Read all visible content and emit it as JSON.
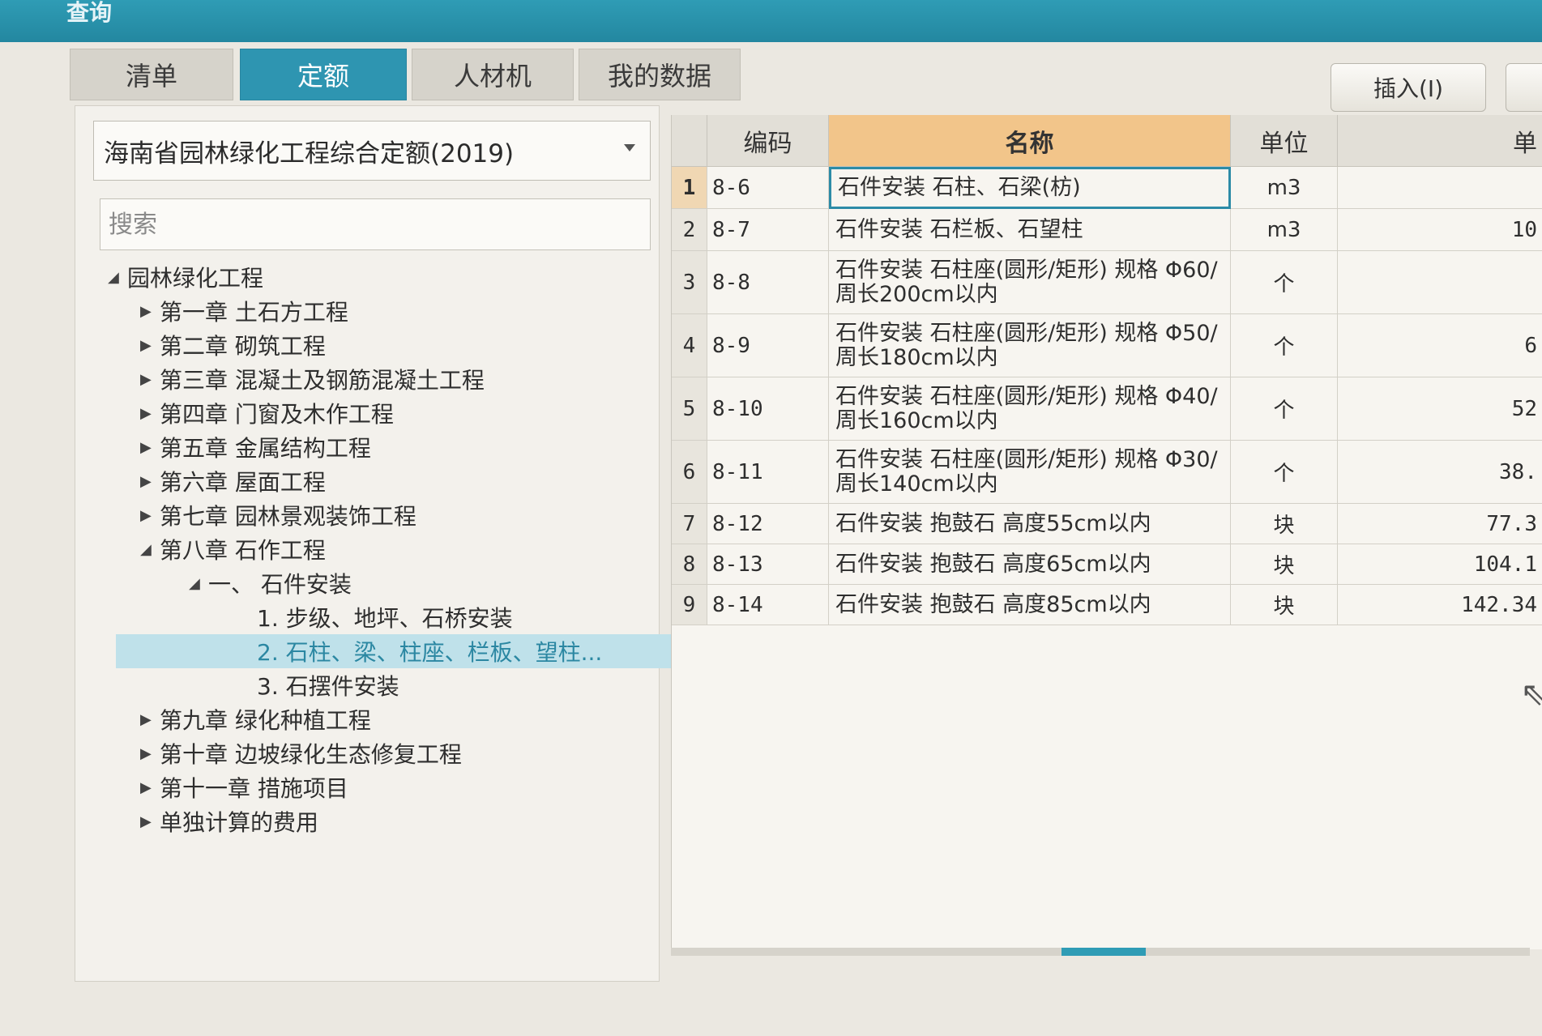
{
  "window": {
    "title": "查询"
  },
  "tabs": [
    {
      "label": "清单",
      "active": false
    },
    {
      "label": "定额",
      "active": true
    },
    {
      "label": "人材机",
      "active": false
    },
    {
      "label": "我的数据",
      "active": false
    }
  ],
  "toolbar": {
    "insert_label": "插入(I)"
  },
  "left": {
    "quota_library": "海南省园林绿化工程综合定额(2019)",
    "search_placeholder": "搜索",
    "tree": [
      {
        "label": "园林绿化工程",
        "arrow": "◢",
        "indent": 0
      },
      {
        "label": "第一章 土石方工程",
        "arrow": "▶",
        "indent": 1
      },
      {
        "label": "第二章 砌筑工程",
        "arrow": "▶",
        "indent": 1
      },
      {
        "label": "第三章 混凝土及钢筋混凝土工程",
        "arrow": "▶",
        "indent": 1
      },
      {
        "label": "第四章 门窗及木作工程",
        "arrow": "▶",
        "indent": 1
      },
      {
        "label": "第五章 金属结构工程",
        "arrow": "▶",
        "indent": 1
      },
      {
        "label": "第六章 屋面工程",
        "arrow": "▶",
        "indent": 1
      },
      {
        "label": "第七章 园林景观装饰工程",
        "arrow": "▶",
        "indent": 1
      },
      {
        "label": "第八章 石作工程",
        "arrow": "◢",
        "indent": 1
      },
      {
        "label": "一、 石件安装",
        "arrow": "◢",
        "indent": 2
      },
      {
        "label": "1. 步级、地坪、石桥安装",
        "arrow": "",
        "indent": 3
      },
      {
        "label": "2. 石柱、梁、柱座、栏板、望柱...",
        "arrow": "",
        "indent": 3,
        "selected": true
      },
      {
        "label": "3. 石摆件安装",
        "arrow": "",
        "indent": 3
      },
      {
        "label": "第九章 绿化种植工程",
        "arrow": "▶",
        "indent": 1
      },
      {
        "label": "第十章 边坡绿化生态修复工程",
        "arrow": "▶",
        "indent": 1
      },
      {
        "label": "第十一章 措施项目",
        "arrow": "▶",
        "indent": 1
      },
      {
        "label": "单独计算的费用",
        "arrow": "▶",
        "indent": 1
      }
    ]
  },
  "grid": {
    "columns": {
      "code": "编码",
      "name": "名称",
      "unit": "单位",
      "price": "单"
    },
    "rows": [
      {
        "idx": "1",
        "code": "8-6",
        "name": "石件安装 石柱、石梁(枋)",
        "unit": "m3",
        "price": ""
      },
      {
        "idx": "2",
        "code": "8-7",
        "name": "石件安装 石栏板、石望柱",
        "unit": "m3",
        "price": "10"
      },
      {
        "idx": "3",
        "code": "8-8",
        "name": "石件安装 石柱座(圆形/矩形) 规格 Φ60/周长200cm以内",
        "unit": "个",
        "price": ""
      },
      {
        "idx": "4",
        "code": "8-9",
        "name": "石件安装 石柱座(圆形/矩形) 规格 Φ50/周长180cm以内",
        "unit": "个",
        "price": "6"
      },
      {
        "idx": "5",
        "code": "8-10",
        "name": "石件安装 石柱座(圆形/矩形) 规格 Φ40/周长160cm以内",
        "unit": "个",
        "price": "52"
      },
      {
        "idx": "6",
        "code": "8-11",
        "name": "石件安装 石柱座(圆形/矩形) 规格 Φ30/周长140cm以内",
        "unit": "个",
        "price": "38."
      },
      {
        "idx": "7",
        "code": "8-12",
        "name": "石件安装 抱鼓石 高度55cm以内",
        "unit": "块",
        "price": "77.3"
      },
      {
        "idx": "8",
        "code": "8-13",
        "name": "石件安装 抱鼓石 高度65cm以内",
        "unit": "块",
        "price": "104.1"
      },
      {
        "idx": "9",
        "code": "8-14",
        "name": "石件安装 抱鼓石 高度85cm以内",
        "unit": "块",
        "price": "142.34"
      }
    ]
  },
  "colors": {
    "accent": "#2e95b1",
    "header_name_bg": "#f2c58a",
    "selection": "#bfe1ea"
  }
}
